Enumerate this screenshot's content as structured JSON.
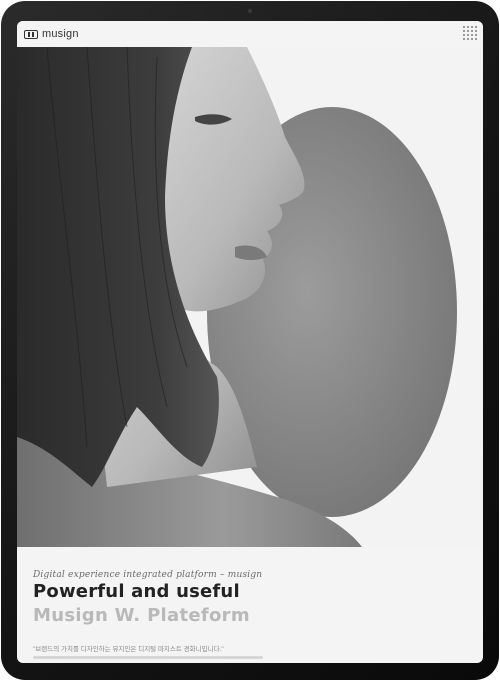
{
  "app": {
    "name": "musign"
  },
  "icons": {
    "logo": "musign-logo-icon",
    "menu": "grid-menu-icon"
  },
  "hero": {
    "tagline": "Digital experience integrated platform – musign"
  },
  "headline": "Powerful and useful",
  "subhead": "Musign W. Plateform",
  "quote": "\"브랜드의 가치를 디자인하는 뮤지인은 디지털 마지스트 경화니입니다.\"",
  "colors": {
    "frame": "#141414",
    "screen_bg": "#f4f4f4",
    "headline": "#222222",
    "subhead": "#b9b9b9",
    "circle": "#8a8a8a"
  }
}
